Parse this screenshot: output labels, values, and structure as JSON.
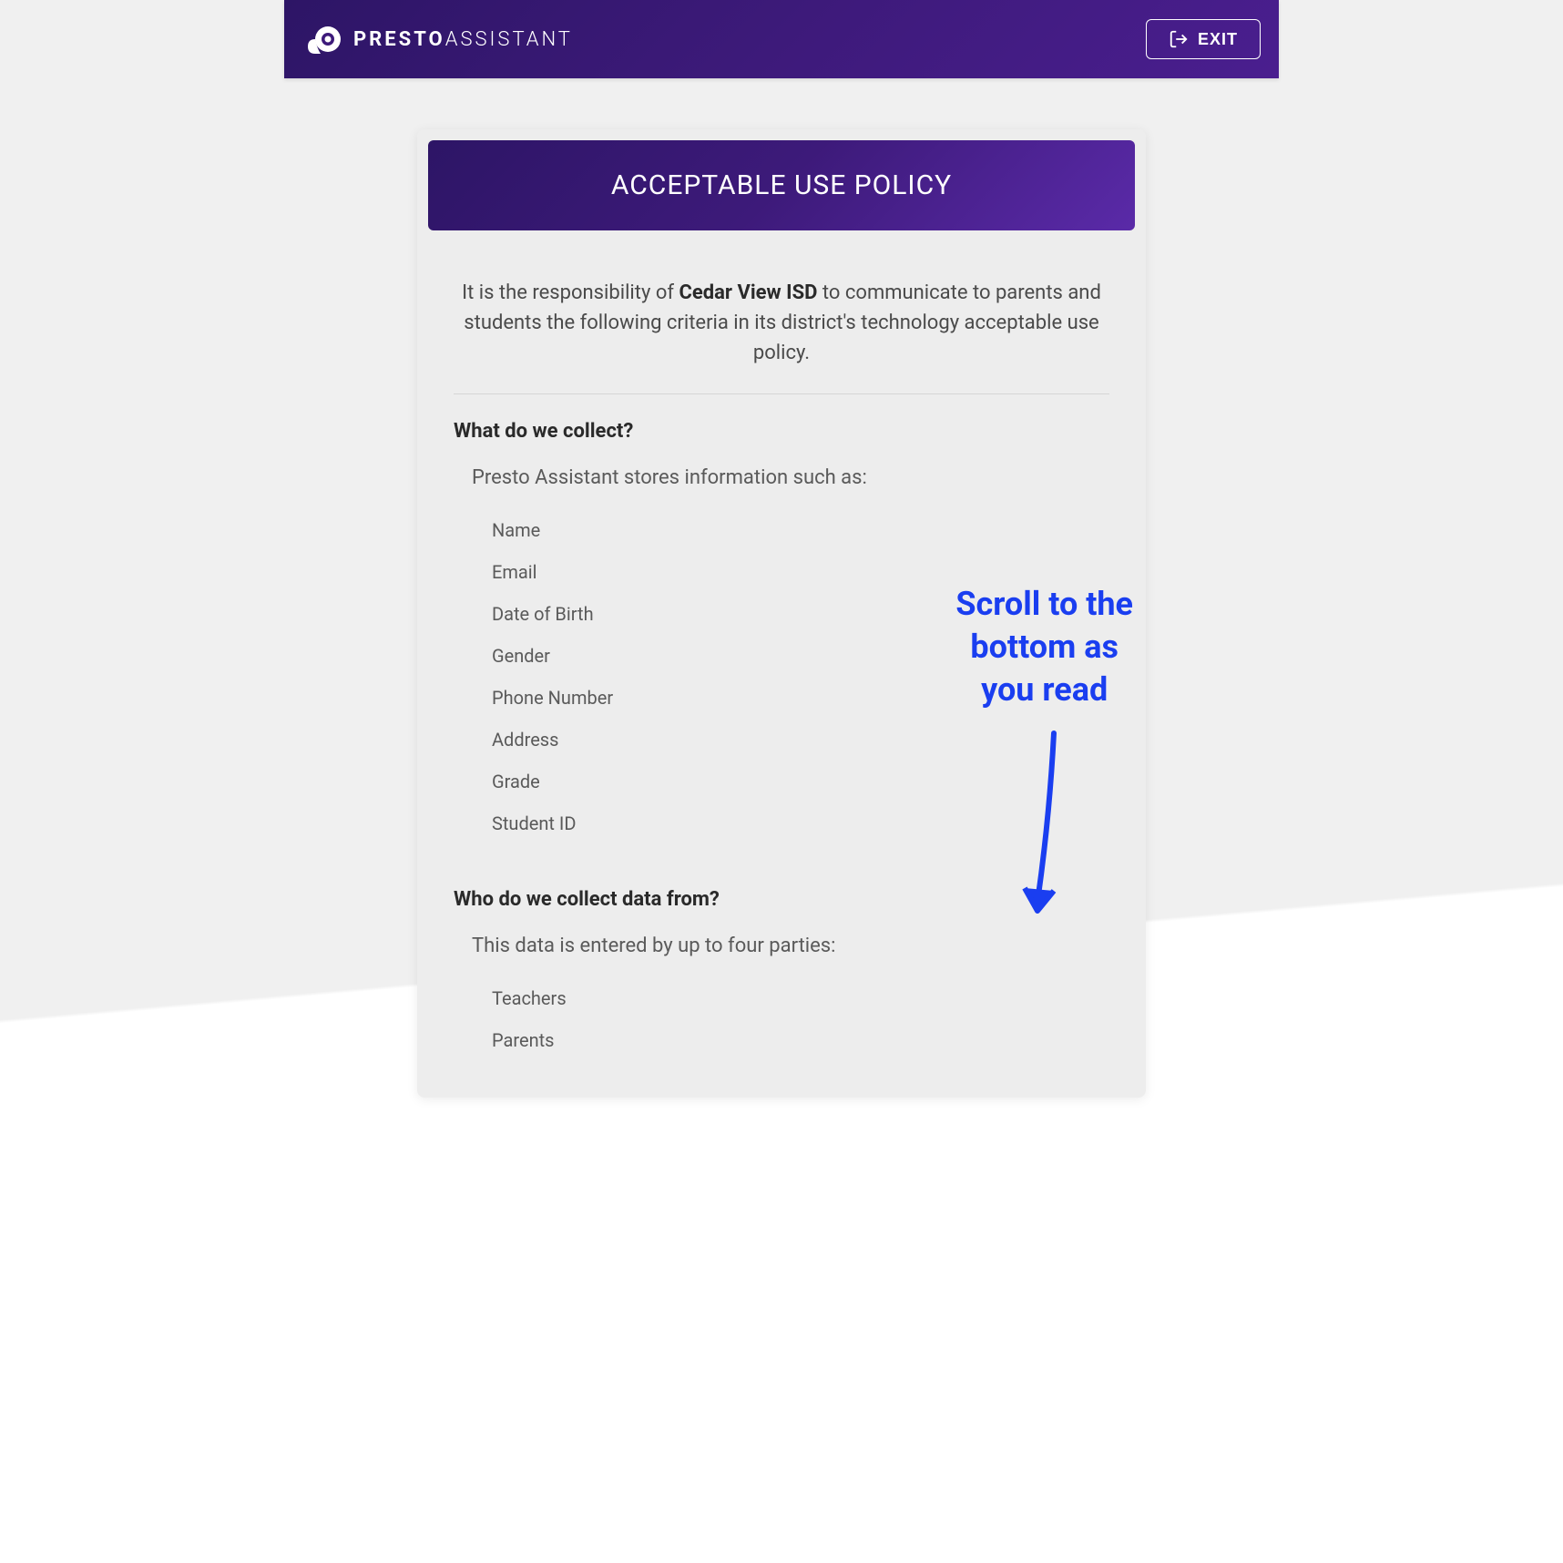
{
  "header": {
    "logo_presto": "PRESTO",
    "logo_assistant": "ASSISTANT",
    "exit_label": "EXIT"
  },
  "card": {
    "title": "ACCEPTABLE USE POLICY",
    "intro_prefix": "It is the responsibility of ",
    "district_name": "Cedar View ISD",
    "intro_suffix": " to communicate to parents and students the following criteria in its district's technology acceptable use policy."
  },
  "section1": {
    "heading": "What do we collect?",
    "subtext": "Presto Assistant stores information such as:",
    "items": [
      "Name",
      "Email",
      "Date of Birth",
      "Gender",
      "Phone Number",
      "Address",
      "Grade",
      "Student ID"
    ]
  },
  "section2": {
    "heading": "Who do we collect data from?",
    "subtext": "This data is entered by up to four parties:",
    "items": [
      "Teachers",
      "Parents"
    ]
  },
  "annotation": {
    "line1": "Scroll to the",
    "line2": "bottom as",
    "line3": "you read"
  }
}
